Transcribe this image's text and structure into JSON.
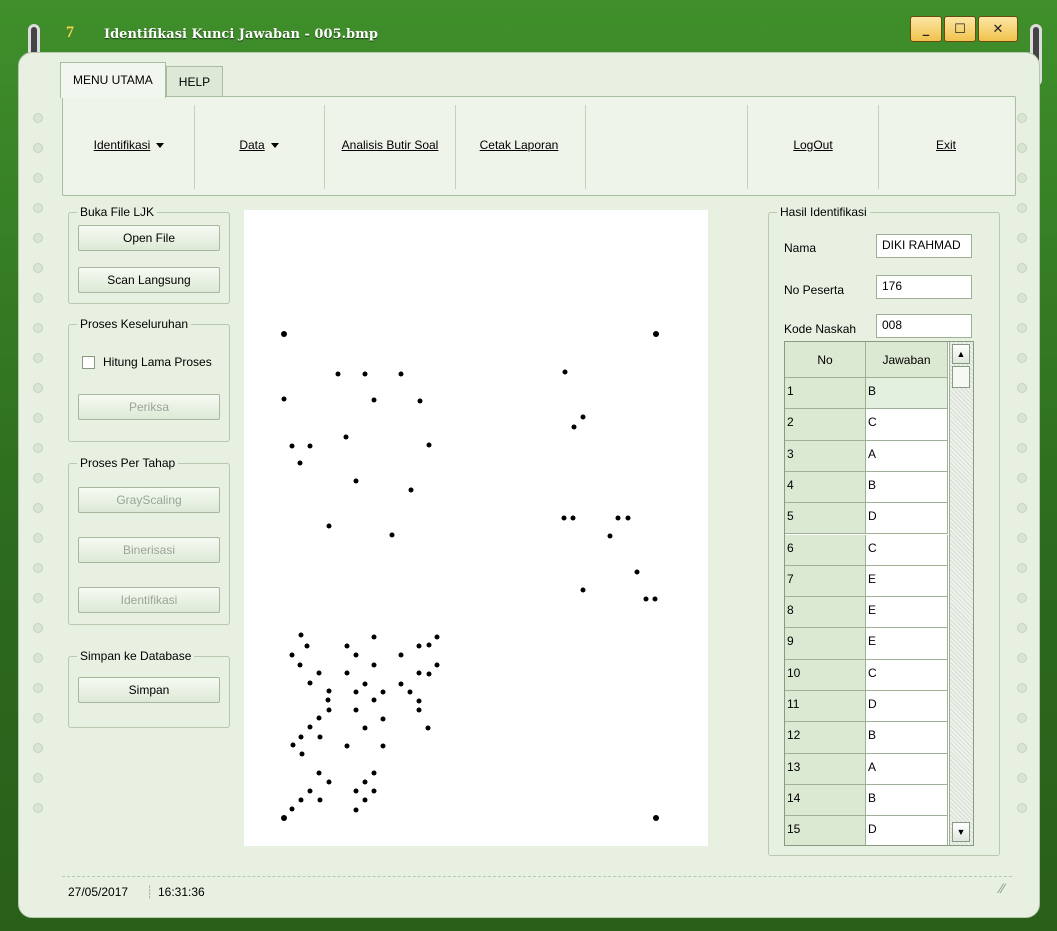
{
  "window": {
    "title": "Identifikasi Kunci Jawaban - 005.bmp",
    "app_icon_glyph": "7",
    "minimize_glyph": "_",
    "maximize_glyph": "☐",
    "close_glyph": "✕"
  },
  "tabs": [
    {
      "label": "MENU UTAMA",
      "active": true
    },
    {
      "label": "HELP",
      "active": false
    }
  ],
  "ribbon": {
    "identifikasi": "Identifikasi",
    "data": "Data",
    "analisis": "Analisis Butir Soal",
    "cetak": "Cetak Laporan",
    "logout": "LogOut",
    "exit": "Exit"
  },
  "buka_file": {
    "title": "Buka File LJK",
    "open_file": "Open File",
    "scan": "Scan Langsung"
  },
  "proses_keseluruhan": {
    "title": "Proses Keseluruhan",
    "hitung": "Hitung Lama Proses",
    "periksa": "Periksa"
  },
  "proses_per_tahap": {
    "title": "Proses Per Tahap",
    "grayscaling": "GrayScaling",
    "binerisasi": "Binerisasi",
    "identifikasi": "Identifikasi"
  },
  "simpan_db": {
    "title": "Simpan ke Database",
    "simpan": "Simpan"
  },
  "hasil": {
    "title": "Hasil Identifikasi",
    "nama_label": "Nama",
    "nama_value": "DIKI RAHMAD",
    "peserta_label": "No Peserta",
    "peserta_value": "176",
    "kode_label": "Kode Naskah",
    "kode_value": "008"
  },
  "grid": {
    "col_no": "No",
    "col_jawaban": "Jawaban",
    "rows": [
      {
        "no": "1",
        "jawaban": "B"
      },
      {
        "no": "2",
        "jawaban": "C"
      },
      {
        "no": "3",
        "jawaban": "A"
      },
      {
        "no": "4",
        "jawaban": "B"
      },
      {
        "no": "5",
        "jawaban": "D"
      },
      {
        "no": "6",
        "jawaban": "C"
      },
      {
        "no": "7",
        "jawaban": "E"
      },
      {
        "no": "8",
        "jawaban": "E"
      },
      {
        "no": "9",
        "jawaban": "E"
      },
      {
        "no": "10",
        "jawaban": "C"
      },
      {
        "no": "11",
        "jawaban": "D"
      },
      {
        "no": "12",
        "jawaban": "B"
      },
      {
        "no": "13",
        "jawaban": "A"
      },
      {
        "no": "14",
        "jawaban": "B"
      },
      {
        "no": "15",
        "jawaban": "D"
      }
    ]
  },
  "status": {
    "date": "27/05/2017",
    "time": "16:31:36"
  }
}
